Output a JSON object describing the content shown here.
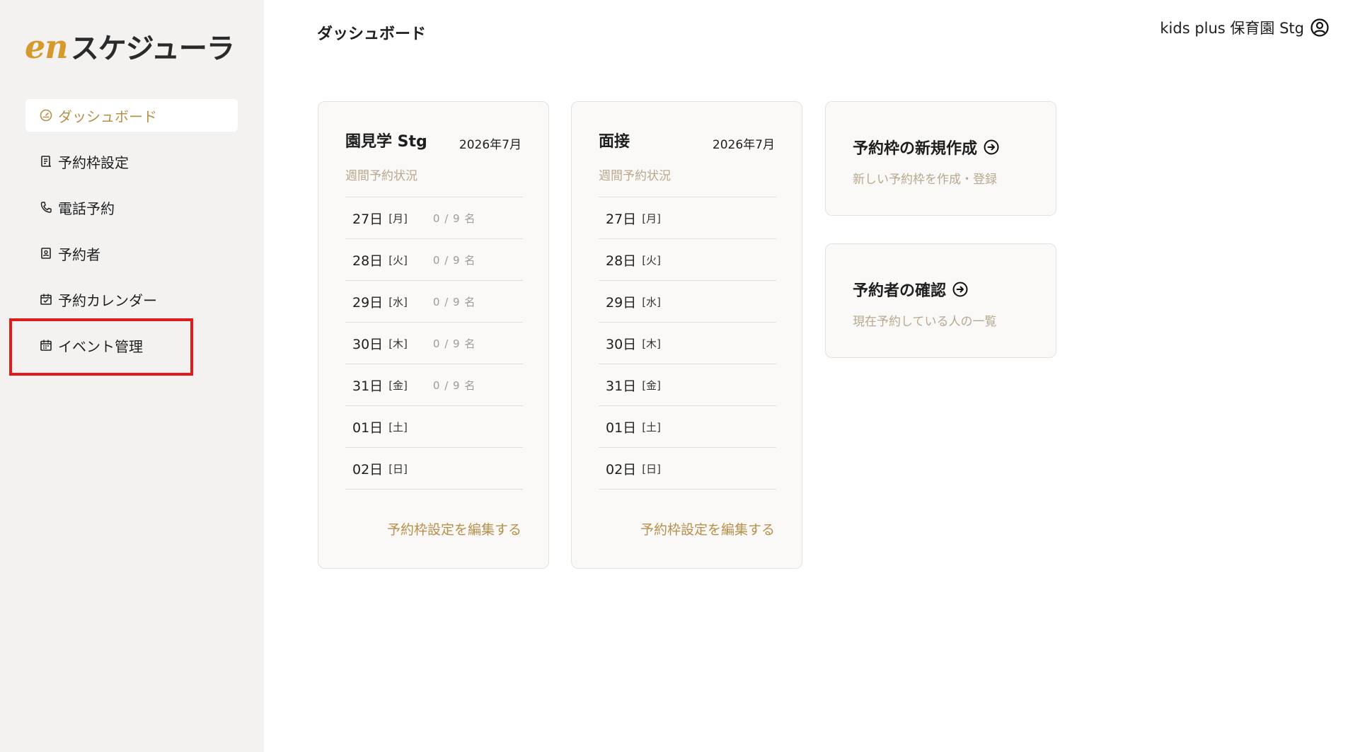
{
  "logo": {
    "en": "en",
    "text": "スケジューラ"
  },
  "sidebar": {
    "items": [
      {
        "label": "ダッシュボード",
        "icon": "dashboard-gauge-icon",
        "active": true
      },
      {
        "label": "予約枠設定",
        "icon": "document-list-icon"
      },
      {
        "label": "電話予約",
        "icon": "phone-icon"
      },
      {
        "label": "予約者",
        "icon": "person-file-icon"
      },
      {
        "label": "予約カレンダー",
        "icon": "calendar-check-icon"
      },
      {
        "label": "イベント管理",
        "icon": "calendar-icon"
      }
    ]
  },
  "header": {
    "title": "ダッシュボード",
    "user_name": "kids plus 保育園 Stg"
  },
  "cards": [
    {
      "title": "園見学 Stg",
      "month": "2026年7月",
      "subtitle": "週間予約状況",
      "rows": [
        {
          "day": "27日",
          "dow": "[月]",
          "count": "0 / 9 名"
        },
        {
          "day": "28日",
          "dow": "[火]",
          "count": "0 / 9 名"
        },
        {
          "day": "29日",
          "dow": "[水]",
          "count": "0 / 9 名"
        },
        {
          "day": "30日",
          "dow": "[木]",
          "count": "0 / 9 名"
        },
        {
          "day": "31日",
          "dow": "[金]",
          "count": "0 / 9 名"
        },
        {
          "day": "01日",
          "dow": "[土]",
          "count": ""
        },
        {
          "day": "02日",
          "dow": "[日]",
          "count": ""
        }
      ],
      "link": "予約枠設定を編集する"
    },
    {
      "title": "面接",
      "month": "2026年7月",
      "subtitle": "週間予約状況",
      "rows": [
        {
          "day": "27日",
          "dow": "[月]",
          "count": ""
        },
        {
          "day": "28日",
          "dow": "[火]",
          "count": ""
        },
        {
          "day": "29日",
          "dow": "[水]",
          "count": ""
        },
        {
          "day": "30日",
          "dow": "[木]",
          "count": ""
        },
        {
          "day": "31日",
          "dow": "[金]",
          "count": ""
        },
        {
          "day": "01日",
          "dow": "[土]",
          "count": ""
        },
        {
          "day": "02日",
          "dow": "[日]",
          "count": ""
        }
      ],
      "link": "予約枠設定を編集する"
    }
  ],
  "actions": [
    {
      "title": "予約枠の新規作成",
      "subtitle": "新しい予約枠を作成・登録",
      "icon": "arrow-circle-right-icon"
    },
    {
      "title": "予約者の確認",
      "subtitle": "現在予約している人の一覧",
      "icon": "arrow-circle-right-icon"
    }
  ],
  "colors": {
    "accent": "#b6904a",
    "logo_accent": "#d49a2c",
    "sidebar_bg": "#f3f2f1",
    "highlight": "#e01b1b"
  }
}
